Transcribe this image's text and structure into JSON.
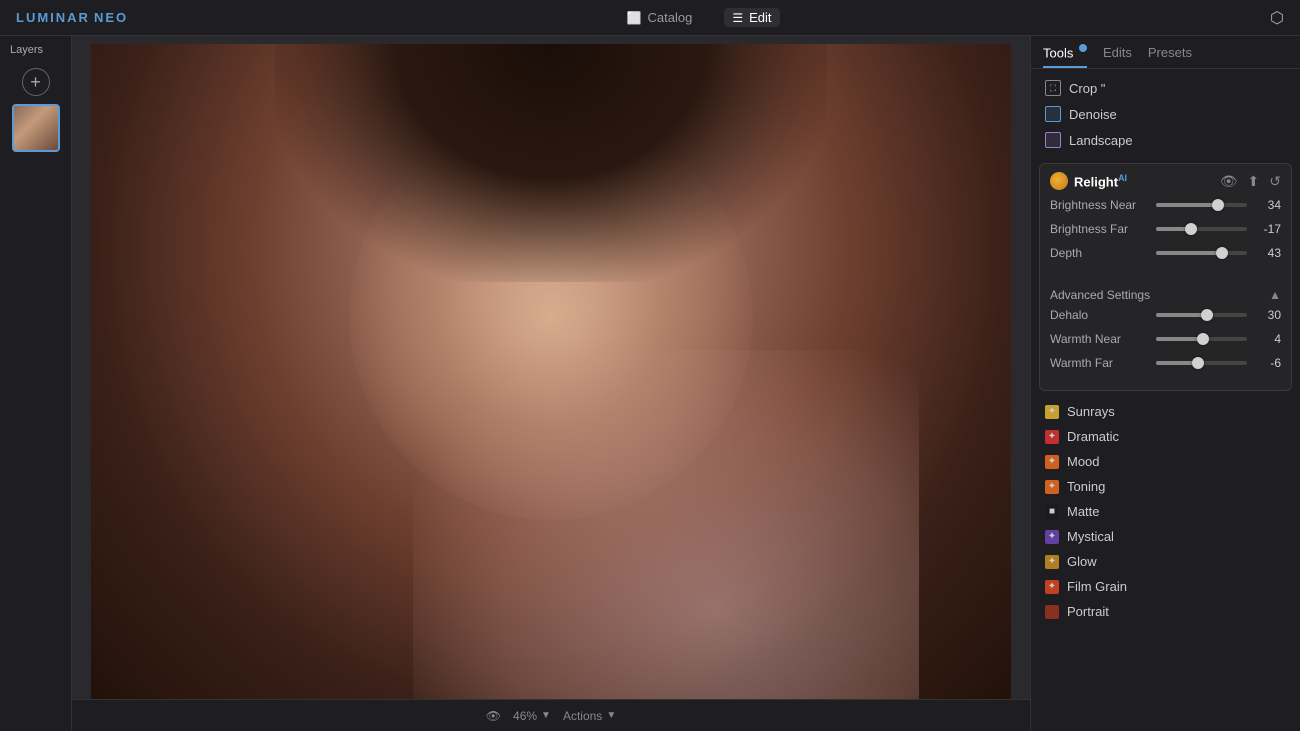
{
  "app": {
    "logo": "LUMINAR",
    "logo_accent": "NEO"
  },
  "topbar": {
    "tabs": [
      {
        "label": "Catalog",
        "icon": "⬜",
        "active": false
      },
      {
        "label": "Edit",
        "icon": "☰",
        "active": true
      }
    ]
  },
  "layers": {
    "title": "Layers",
    "add_label": "+"
  },
  "tools_tabs": [
    {
      "label": "Tools",
      "active": true,
      "badge": true
    },
    {
      "label": "Edits",
      "active": false,
      "badge": false
    },
    {
      "label": "Presets",
      "active": false,
      "badge": false
    }
  ],
  "tool_items": [
    {
      "label": "Crop \"",
      "icon_type": "plain",
      "icon_char": "⛶"
    },
    {
      "label": "Denoise",
      "icon_type": "blue",
      "icon_char": ""
    },
    {
      "label": "Landscape",
      "icon_type": "purple",
      "icon_char": ""
    }
  ],
  "relight": {
    "title": "Relight",
    "ai_badge": "AI",
    "sliders": [
      {
        "label": "Brightness Near",
        "value": 34,
        "percent": 68
      },
      {
        "label": "Brightness Far",
        "value": -17,
        "percent": 38
      },
      {
        "label": "Depth",
        "value": 43,
        "percent": 72
      }
    ]
  },
  "advanced_settings": {
    "title": "Advanced Settings",
    "expanded": true,
    "sliders": [
      {
        "label": "Dehalo",
        "value": 30,
        "percent": 56
      },
      {
        "label": "Warmth Near",
        "value": 4,
        "percent": 52
      },
      {
        "label": "Warmth Far",
        "value": -6,
        "percent": 46
      }
    ]
  },
  "list_items": [
    {
      "label": "Sunrays",
      "color": "dot-yellow",
      "char": "✦"
    },
    {
      "label": "Dramatic",
      "color": "dot-red",
      "char": "✦"
    },
    {
      "label": "Mood",
      "color": "dot-orange",
      "char": "✦"
    },
    {
      "label": "Toning",
      "color": "dot-orange",
      "char": "✦"
    },
    {
      "label": "Matte",
      "color": "dot-dark",
      "char": "■"
    },
    {
      "label": "Mystical",
      "color": "dot-purple",
      "char": "✦"
    },
    {
      "label": "Glow",
      "color": "dot-gold",
      "char": "✦"
    },
    {
      "label": "Film Grain",
      "color": "dot-film",
      "char": "✦"
    },
    {
      "label": "Portrait",
      "color": "dot-brown",
      "char": ""
    }
  ],
  "bottombar": {
    "zoom_label": "46%",
    "actions_label": "Actions"
  }
}
